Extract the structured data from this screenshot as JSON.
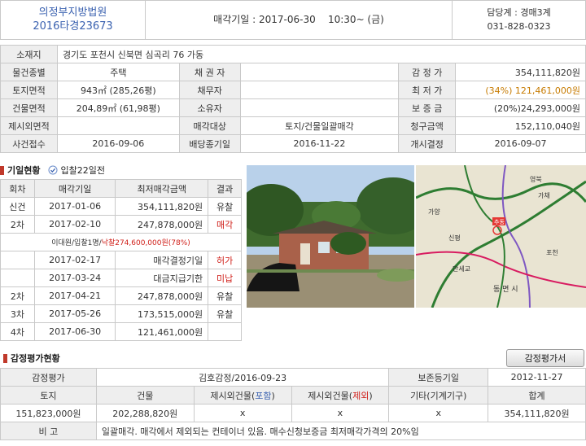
{
  "header": {
    "court": "의정부지방법원",
    "case_no": "2016타경23673",
    "sale_date": "매각기일 : 2017-06-30    10:30~ (금)",
    "dept": "담당계 : 경매3계",
    "phone": "031-828-0323"
  },
  "info": {
    "address_label": "소재지",
    "address": "경기도 포천시 신북면 심곡리 76 가동",
    "type_label": "물건종별",
    "type": "주택",
    "creditor_label": "채 권 자",
    "creditor": "",
    "appraisal_label": "감 정 가",
    "appraisal": "354,111,820원",
    "land_label": "토지면적",
    "land": "943㎡ (285,26평)",
    "debtor_label": "채무자",
    "debtor": "",
    "min_label": "최 저 가",
    "min": "(34%) 121,461,000원",
    "bldg_label": "건물면적",
    "bldg": "204,89㎡ (61,98평)",
    "owner_label": "소유자",
    "owner": "",
    "deposit_label": "보 증 금",
    "deposit": "(20%)24,293,000원",
    "excl_label": "제시외면적",
    "excl": "",
    "target_label": "매각대상",
    "target": "토지/건물일괄매각",
    "claim_label": "청구금액",
    "claim": "152,110,040원",
    "recv_label": "사건접수",
    "recv": "2016-09-06",
    "divend_label": "배당종기일",
    "divend": "2016-11-22",
    "start_label": "개시결정",
    "start": "2016-09-07"
  },
  "history": {
    "title": "기일현황",
    "badge": "입찰22일전",
    "headers": [
      "회차",
      "매각기일",
      "최저매각금액",
      "결과"
    ],
    "rows": [
      {
        "round": "신건",
        "date": "2017-01-06",
        "amount": "354,111,820원",
        "result": "유찰"
      },
      {
        "round": "2차",
        "date": "2017-02-10",
        "amount": "247,878,000원",
        "result": "매각"
      },
      {
        "round": "",
        "date": "2017-02-17",
        "amount": "매각결정기일",
        "result": "허가"
      },
      {
        "round": "",
        "date": "2017-03-24",
        "amount": "대금지급기한",
        "result": "미납"
      },
      {
        "round": "2차",
        "date": "2017-04-21",
        "amount": "247,878,000원",
        "result": "유찰"
      },
      {
        "round": "3차",
        "date": "2017-05-26",
        "amount": "173,515,000원",
        "result": "유찰"
      },
      {
        "round": "4차",
        "date": "2017-06-30",
        "amount": "121,461,000원",
        "result": ""
      }
    ],
    "winner_note_a": "이대원/입찰1명/",
    "winner_note_b": "낙찰274,600,000원(78%)"
  },
  "map": {
    "labels": [
      "추동",
      "신평",
      "만세교",
      "가채",
      "포천",
      "영북",
      "가양",
      "동 면 시"
    ]
  },
  "appraisal_sec": {
    "title": "감정평가현황",
    "button": "감정평가서",
    "r1": [
      "감정평가",
      "김호감정/2016-09-23",
      "보존등기일",
      "2012-11-27"
    ],
    "headers": [
      "토지",
      "건물",
      "제시외건물(",
      "포함",
      ")",
      "제시외건물(",
      "제외",
      ")",
      "기타(기계기구)",
      "합계"
    ],
    "values": [
      "151,823,000원",
      "202,288,820원",
      "x",
      "x",
      "x",
      "354,111,820원"
    ],
    "note_label": "비 고",
    "note": "일괄매각. 매각에서 제외되는 컨테이너 있음. 매수신청보증금 최저매각가격의 20%임"
  },
  "colors": {
    "red": "#d0201a",
    "blue": "#3b62b0",
    "header_bg": "#eeeeee"
  }
}
